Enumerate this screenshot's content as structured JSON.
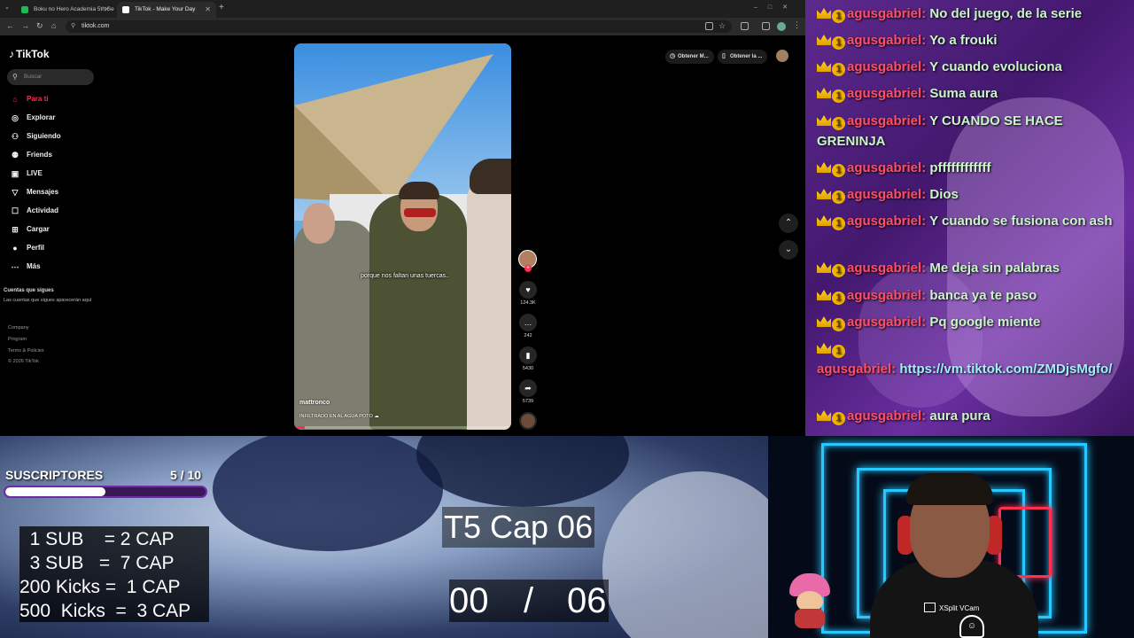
{
  "browser": {
    "tabs": [
      {
        "title": "Boku no Hero Academia 5th Se",
        "favicon_color": "#1db954",
        "active": false
      },
      {
        "title": "TikTok - Make Your Day",
        "favicon_color": "#ffffff",
        "active": true
      }
    ],
    "url": "tiktok.com"
  },
  "tiktok": {
    "logo": "TikTok",
    "search_placeholder": "Buscar",
    "nav": [
      {
        "label": "Para ti",
        "icon": "home-icon",
        "glyph": "⌂",
        "active": true
      },
      {
        "label": "Explorar",
        "icon": "compass-icon",
        "glyph": "◎",
        "active": false
      },
      {
        "label": "Siguiendo",
        "icon": "following-icon",
        "glyph": "⚇",
        "active": false
      },
      {
        "label": "Friends",
        "icon": "friends-icon",
        "glyph": "⚉",
        "active": false
      },
      {
        "label": "LIVE",
        "icon": "live-icon",
        "glyph": "▣",
        "active": false
      },
      {
        "label": "Mensajes",
        "icon": "messages-icon",
        "glyph": "▽",
        "active": false
      },
      {
        "label": "Actividad",
        "icon": "activity-icon",
        "glyph": "☐",
        "active": false
      },
      {
        "label": "Cargar",
        "icon": "upload-icon",
        "glyph": "⊞",
        "active": false
      },
      {
        "label": "Perfil",
        "icon": "profile-icon",
        "glyph": "●",
        "active": false
      },
      {
        "label": "Más",
        "icon": "more-icon",
        "glyph": "⋯",
        "active": false
      }
    ],
    "following_heading": "Cuentas que sigues",
    "following_empty": "Las cuentas que sigues aparecerán aquí",
    "footer": [
      "Company",
      "Program",
      "Terms & Policies",
      "© 2026 TikTok"
    ],
    "get_app_buttons": [
      "Obtener M...",
      "Obtener la ..."
    ],
    "video": {
      "caption": "porque nos faltan unas tuercas..",
      "author": "mattronco",
      "description": "INFILTRADO EN AL AGUA POTO ☁",
      "progress": 0.05
    },
    "actions": {
      "likes": "124.3K",
      "comments": "242",
      "saves": "5430",
      "shares": "5739"
    },
    "accent": "#fe2c55"
  },
  "chat": {
    "username": "agusgabriel:",
    "badge_number": "1",
    "messages": [
      "No del juego, de la serie",
      "Yo a frouki",
      "Y cuando evoluciona",
      "Suma aura",
      "Y CUANDO SE HACE GRENINJA",
      "pffffffffffff",
      "Dios",
      "Y cuando se fusiona con ash",
      "Me deja sin palabras",
      "banca ya te paso",
      "Pq google miente",
      "https://vm.tiktok.com/ZMDjsMgfo/",
      "aura pura"
    ]
  },
  "overlay": {
    "sub_label": "SUSCRIPTORES",
    "sub_count": "5  / 10",
    "sub_progress": 0.5,
    "rules": [
      "  1 SUB    = 2 CAP",
      "  3 SUB   =  7 CAP",
      "200 Kicks =  1 CAP",
      "500  Kicks  =  3 CAP"
    ],
    "episode_title": "T5 Cap 06",
    "episode_current": "00",
    "episode_sep": "/",
    "episode_total": "06"
  },
  "webcam": {
    "watermark": "XSplit VCam"
  }
}
